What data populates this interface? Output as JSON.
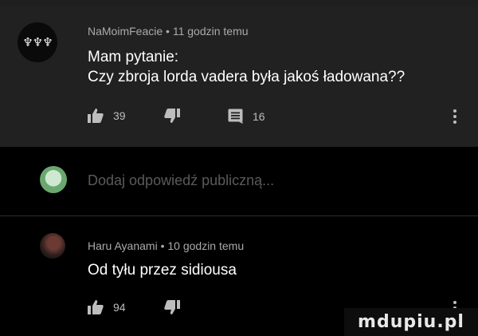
{
  "comment": {
    "avatar_icon": "avatar-logo-icon",
    "author": "NaMoimFeacie",
    "separator": "•",
    "time": "11 godzin temu",
    "text_line1": "Mam pytanie:",
    "text_line2": "Czy zbroja lorda vadera była jakoś ładowana??",
    "like_count": "39",
    "reply_count": "16"
  },
  "reply_box": {
    "placeholder": "Dodaj odpowiedź publiczną..."
  },
  "reply": {
    "author": "Haru Ayanami",
    "separator": "•",
    "time": "10 godzin temu",
    "text": "Od tyłu przez sidiousa",
    "like_count": "94"
  },
  "icons": {
    "like": "thumbs-up-icon",
    "dislike": "thumbs-down-icon",
    "reply": "comment-icon",
    "menu": "more-vertical-icon"
  },
  "colors": {
    "card_background": "#212121",
    "page_background": "#000000",
    "meta_text": "#aaaaaa",
    "body_text": "#ffffff",
    "placeholder_text": "#5a5a5a"
  }
}
